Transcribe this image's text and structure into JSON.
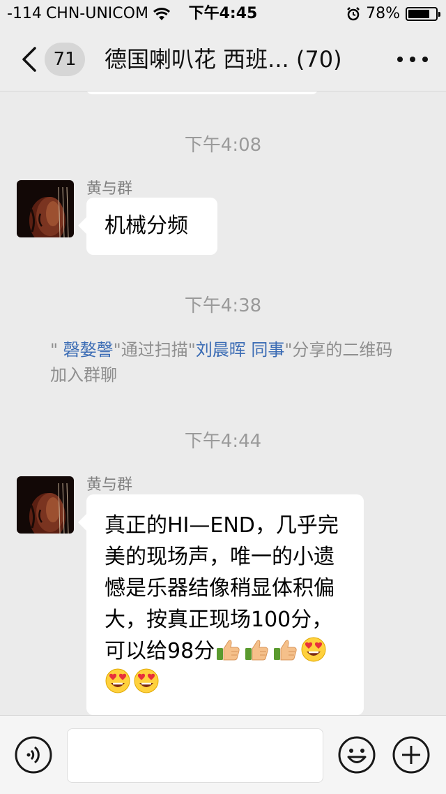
{
  "status_bar": {
    "signal": "-114",
    "carrier": "CHN-UNICOM",
    "time": "下午4:45",
    "battery": "78%",
    "battery_level": 0.78
  },
  "nav": {
    "unread_count": "71",
    "title": "德国喇叭花 西班... (70)"
  },
  "messages": [
    {
      "timestamp": "下午4:08",
      "sender": "黄与群",
      "text": "机械分频"
    },
    {
      "timestamp": "下午4:38",
      "system": {
        "quote_open": "\" ",
        "name1": "磬嫯謦",
        "mid": "\"通过扫描\"",
        "name2": "刘晨晖 同事",
        "tail": "\"分享的二维码加入群聊"
      }
    },
    {
      "timestamp": "下午4:44",
      "sender": "黄与群",
      "text": "真正的HI—END，几乎完美的现场声，唯一的小遗憾是乐器结像稍显体积偏大，按真正现场100分，可以给98分",
      "emojis": [
        "thumbs-up-icon",
        "thumbs-up-icon",
        "thumbs-up-icon",
        "heart-eyes-icon",
        "heart-eyes-icon",
        "heart-eyes-icon"
      ]
    }
  ],
  "colors": {
    "background": "#ebebeb",
    "bubble": "#ffffff",
    "link": "#3a6bb4",
    "timestamp": "#9a9a9a"
  }
}
